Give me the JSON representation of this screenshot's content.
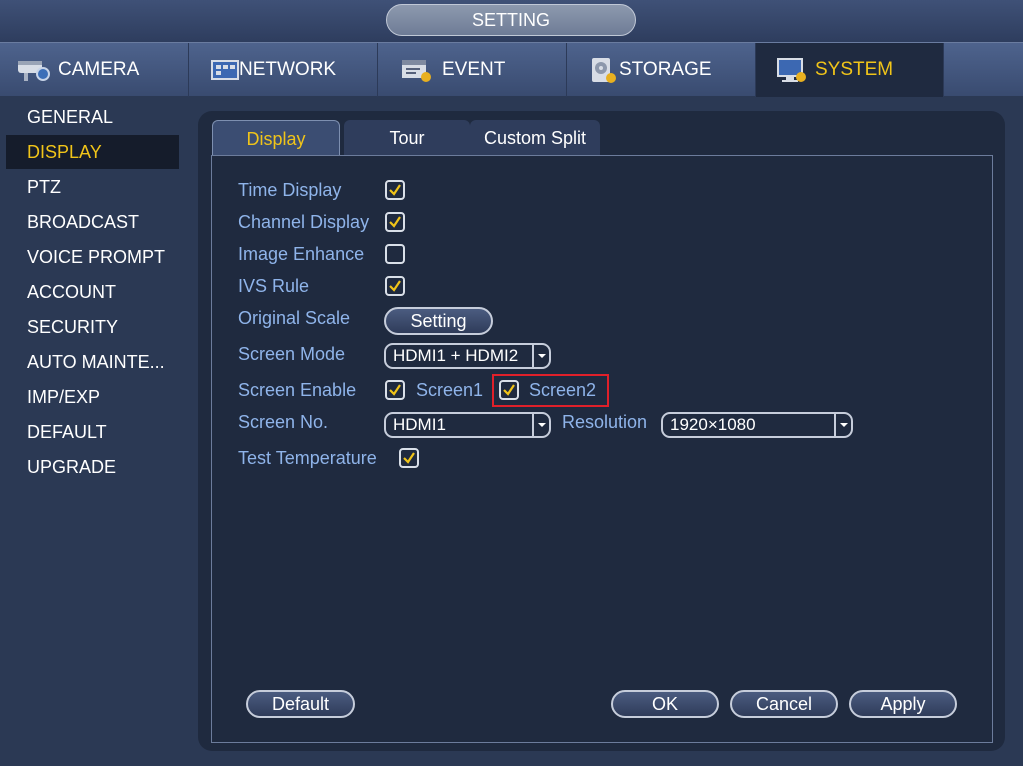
{
  "title": "SETTING",
  "main_tabs": [
    {
      "label": "CAMERA",
      "icon": "camera-icon"
    },
    {
      "label": "NETWORK",
      "icon": "network-icon"
    },
    {
      "label": "EVENT",
      "icon": "event-icon"
    },
    {
      "label": "STORAGE",
      "icon": "storage-icon"
    },
    {
      "label": "SYSTEM",
      "icon": "system-icon",
      "active": true
    }
  ],
  "sidebar": {
    "items": [
      "GENERAL",
      "DISPLAY",
      "PTZ",
      "BROADCAST",
      "VOICE PROMPT",
      "ACCOUNT",
      "SECURITY",
      "AUTO MAINTE...",
      "IMP/EXP",
      "DEFAULT",
      "UPGRADE"
    ],
    "active": "DISPLAY"
  },
  "sub_tabs": [
    {
      "label": "Display",
      "active": true
    },
    {
      "label": "Tour"
    },
    {
      "label": "Custom Split"
    }
  ],
  "form": {
    "time_display": {
      "label": "Time Display",
      "checked": true
    },
    "channel_display": {
      "label": "Channel Display",
      "checked": true
    },
    "image_enhance": {
      "label": "Image Enhance",
      "checked": false
    },
    "ivs_rule": {
      "label": "IVS Rule",
      "checked": true
    },
    "original_scale": {
      "label": "Original Scale",
      "button": "Setting"
    },
    "screen_mode": {
      "label": "Screen Mode",
      "value": "HDMI1 + HDMI2"
    },
    "screen_enable": {
      "label": "Screen Enable",
      "screen1": "Screen1",
      "screen1_checked": true,
      "screen2": "Screen2",
      "screen2_checked": true
    },
    "screen_no": {
      "label": "Screen No.",
      "value": "HDMI1"
    },
    "resolution": {
      "label": "Resolution",
      "value": "1920×1080"
    },
    "test_temperature": {
      "label": "Test Temperature",
      "checked": true
    }
  },
  "buttons": {
    "default": "Default",
    "ok": "OK",
    "cancel": "Cancel",
    "apply": "Apply"
  },
  "colors": {
    "accent": "#f0c419",
    "label": "#8fb4ea",
    "highlight": "#e0202a"
  }
}
